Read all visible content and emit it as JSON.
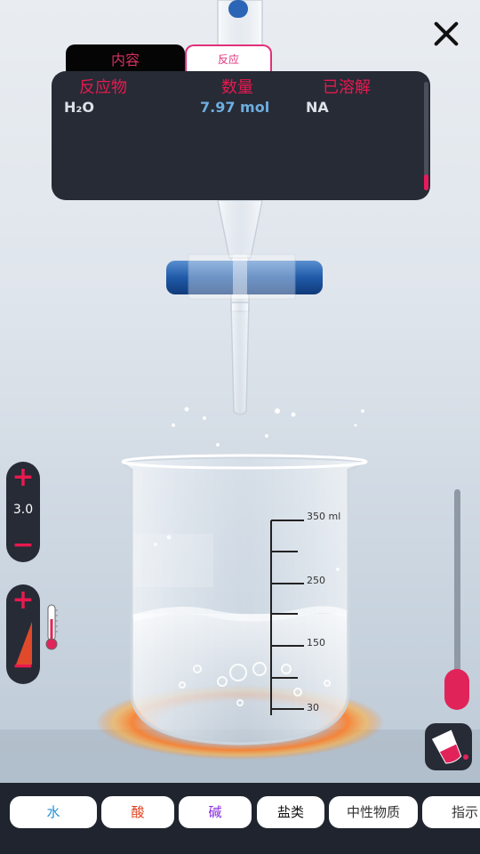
{
  "panel": {
    "tabs": [
      {
        "label": "内容"
      },
      {
        "label": "反应"
      }
    ],
    "columns": [
      "反应物",
      "数量",
      "已溶解"
    ],
    "rows": [
      {
        "reactant": "H₂O",
        "amount": "7.97 mol",
        "dissolved": "NA"
      }
    ]
  },
  "controls": {
    "amount_value": "3.0"
  },
  "beaker": {
    "scale_labels": [
      "350 ml",
      "250",
      "150",
      "30"
    ]
  },
  "categories": [
    {
      "label": "水",
      "color": "#1e8fd8"
    },
    {
      "label": "酸",
      "color": "#e0401a"
    },
    {
      "label": "碱",
      "color": "#8a2be2"
    },
    {
      "label": "盐类",
      "color": "#111111"
    },
    {
      "label": "中性物质",
      "color": "#333333"
    },
    {
      "label": "指示",
      "color": "#333333"
    }
  ],
  "colors": {
    "accent": "#e8194e",
    "panel_bg": "#262b36",
    "amount_text": "#6eaee0"
  },
  "icons": [
    "close-icon",
    "thermometer-icon",
    "beaker-icon",
    "burette",
    "beaker"
  ]
}
